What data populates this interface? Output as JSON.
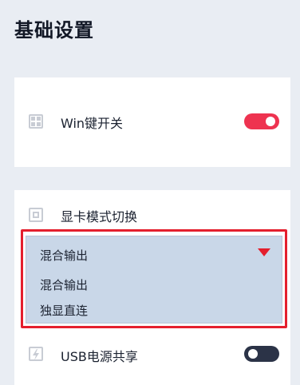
{
  "page": {
    "title": "基础设置"
  },
  "win_key": {
    "label": "Win键开关",
    "enabled": true,
    "icon": "windows-icon",
    "toggle_color": "#ee3350"
  },
  "gpu_mode": {
    "label": "显卡模式切换",
    "icon": "gpu-icon",
    "selected": "混合输出",
    "options": [
      "混合输出",
      "独显直连"
    ],
    "dropdown_bg": "#c9d7e8",
    "highlight_color": "#e41f2d"
  },
  "usb_power": {
    "label": "USB电源共享",
    "enabled": false,
    "icon": "power-bolt-icon",
    "toggle_color": "#2b3347"
  }
}
